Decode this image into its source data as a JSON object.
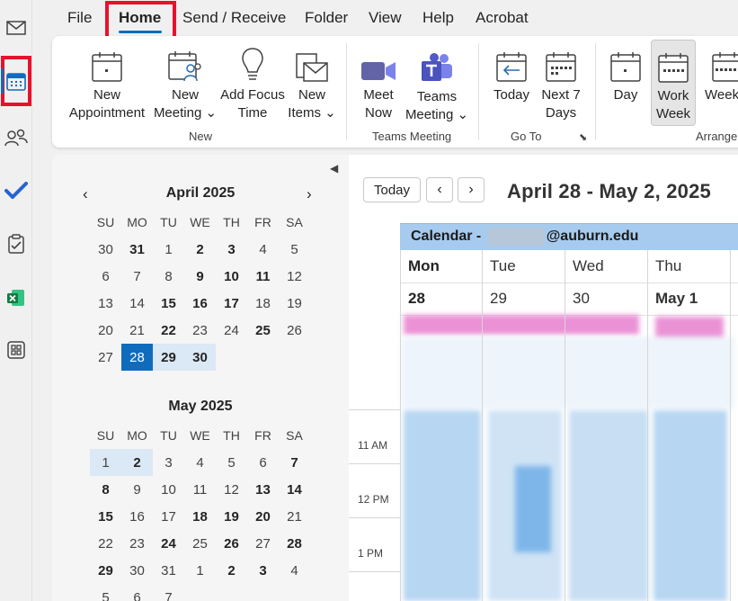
{
  "rail": {
    "items": [
      {
        "name": "mail-icon"
      },
      {
        "name": "calendar-icon",
        "active": true
      },
      {
        "name": "people-icon"
      },
      {
        "name": "todo-check-icon"
      },
      {
        "name": "tasks-clipboard-icon"
      },
      {
        "name": "app-excel-icon"
      },
      {
        "name": "more-apps-icon"
      }
    ]
  },
  "menu": {
    "tabs": [
      "File",
      "Home",
      "Send / Receive",
      "Folder",
      "View",
      "Help",
      "Acrobat"
    ],
    "active": "Home"
  },
  "ribbon": {
    "new_appointment": "New Appointment",
    "new_appointment_l1": "New",
    "new_appointment_l2": "Appointment",
    "new_meeting_l1": "New",
    "new_meeting_l2": "Meeting ⌄",
    "add_focus_l1": "Add Focus",
    "add_focus_l2": "Time",
    "new_items_l1": "New",
    "new_items_l2": "Items ⌄",
    "group_new": "New",
    "meet_now_l1": "Meet",
    "meet_now_l2": "Now",
    "teams_meeting_l1": "Teams",
    "teams_meeting_l2": "Meeting ⌄",
    "group_teams": "Teams Meeting",
    "today": "Today",
    "next7_l1": "Next 7",
    "next7_l2": "Days",
    "group_goto": "Go To",
    "day": "Day",
    "work_week_l1": "Work",
    "work_week_l2": "Week",
    "week": "Week",
    "group_arrange": "Arrange"
  },
  "mini_cal": {
    "weekdays": [
      "SU",
      "MO",
      "TU",
      "WE",
      "TH",
      "FR",
      "SA"
    ],
    "april": {
      "title": "April 2025",
      "days": [
        "30",
        "31",
        "1",
        "2",
        "3",
        "4",
        "5",
        "6",
        "7",
        "8",
        "9",
        "10",
        "11",
        "12",
        "13",
        "14",
        "15",
        "16",
        "17",
        "18",
        "19",
        "20",
        "21",
        "22",
        "23",
        "24",
        "25",
        "26",
        "27",
        "28",
        "29",
        "30"
      ]
    },
    "may": {
      "title": "May 2025",
      "days": [
        "1",
        "2",
        "3",
        "4",
        "5",
        "6",
        "7",
        "8",
        "9",
        "10",
        "11",
        "12",
        "13",
        "14",
        "15",
        "16",
        "17",
        "18",
        "19",
        "20",
        "21",
        "22",
        "23",
        "24",
        "25",
        "26",
        "27",
        "28",
        "29",
        "30",
        "31",
        "1",
        "2",
        "3",
        "4",
        "5",
        "6",
        "7"
      ]
    }
  },
  "main": {
    "today_button": "Today",
    "prev": "‹",
    "next": "›",
    "range_title": "April 28 - May 2, 2025",
    "calendar_prefix": "Calendar - ",
    "calendar_domain": "@auburn.edu",
    "days": [
      {
        "name": "Mon",
        "num": "28"
      },
      {
        "name": "Tue",
        "num": "29"
      },
      {
        "name": "Wed",
        "num": "30"
      },
      {
        "name": "Thu",
        "num": "May 1"
      }
    ],
    "times": [
      "11 AM",
      "12 PM",
      "1 PM"
    ]
  },
  "colors": {
    "accent": "#0f6cbd",
    "highlight_red": "#e8112d",
    "calendar_header": "#a6cbee",
    "event_blue": "#b7d6f2",
    "event_pink": "#e87fcf"
  }
}
